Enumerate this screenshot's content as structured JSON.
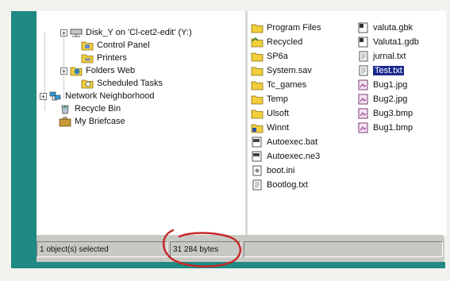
{
  "tree": [
    {
      "label": "Disk_Y on 'Cl-cet2-edit' (Y:)",
      "icon": "network-drive-icon",
      "expander": "+"
    },
    {
      "label": "Control Panel",
      "icon": "control-panel-icon",
      "expander": ""
    },
    {
      "label": "Printers",
      "icon": "printers-icon",
      "expander": ""
    },
    {
      "label": "Folders Web",
      "icon": "web-folder-icon",
      "expander": "+"
    },
    {
      "label": "Scheduled Tasks",
      "icon": "scheduled-tasks-icon",
      "expander": ""
    },
    {
      "label": "Network Neighborhood",
      "icon": "network-icon",
      "expander": "+"
    },
    {
      "label": "Recycle Bin",
      "icon": "recycle-bin-icon",
      "expander": ""
    },
    {
      "label": "My Briefcase",
      "icon": "briefcase-icon",
      "expander": ""
    }
  ],
  "files_col1": [
    {
      "label": "Program Files",
      "icon": "folder-icon"
    },
    {
      "label": "Recycled",
      "icon": "recycle-folder-icon"
    },
    {
      "label": "SP6a",
      "icon": "folder-icon"
    },
    {
      "label": "System.sav",
      "icon": "folder-icon"
    },
    {
      "label": "Tc_games",
      "icon": "folder-icon"
    },
    {
      "label": "Temp",
      "icon": "folder-icon"
    },
    {
      "label": "Ulsoft",
      "icon": "folder-icon"
    },
    {
      "label": "Winnt",
      "icon": "windows-folder-icon"
    },
    {
      "label": "Autoexec.bat",
      "icon": "batch-file-icon"
    },
    {
      "label": "Autoexec.ne3",
      "icon": "batch-file-icon"
    },
    {
      "label": "boot.ini",
      "icon": "ini-file-icon"
    },
    {
      "label": "Bootlog.txt",
      "icon": "text-file-icon"
    }
  ],
  "files_col2": [
    {
      "label": "valuta.gbk",
      "icon": "database-file-icon",
      "selected": false
    },
    {
      "label": "Valuta1.gdb",
      "icon": "database-file-icon",
      "selected": false
    },
    {
      "label": "jurnal.txt",
      "icon": "text-file-icon",
      "selected": false
    },
    {
      "label": "Test.txt",
      "icon": "text-file-icon",
      "selected": true
    },
    {
      "label": "Bug1.jpg",
      "icon": "image-file-icon",
      "selected": false
    },
    {
      "label": "Bug2.jpg",
      "icon": "image-file-icon",
      "selected": false
    },
    {
      "label": "Bug3.bmp",
      "icon": "image-file-icon",
      "selected": false
    },
    {
      "label": "Bug1.bmp",
      "icon": "image-file-icon",
      "selected": false
    }
  ],
  "status": {
    "selected_text": "1 object(s) selected",
    "size_text": "31 284 bytes"
  },
  "colors": {
    "accent": "#1f8a82",
    "selection": "#1b2a8f",
    "annotation": "#c62828"
  }
}
